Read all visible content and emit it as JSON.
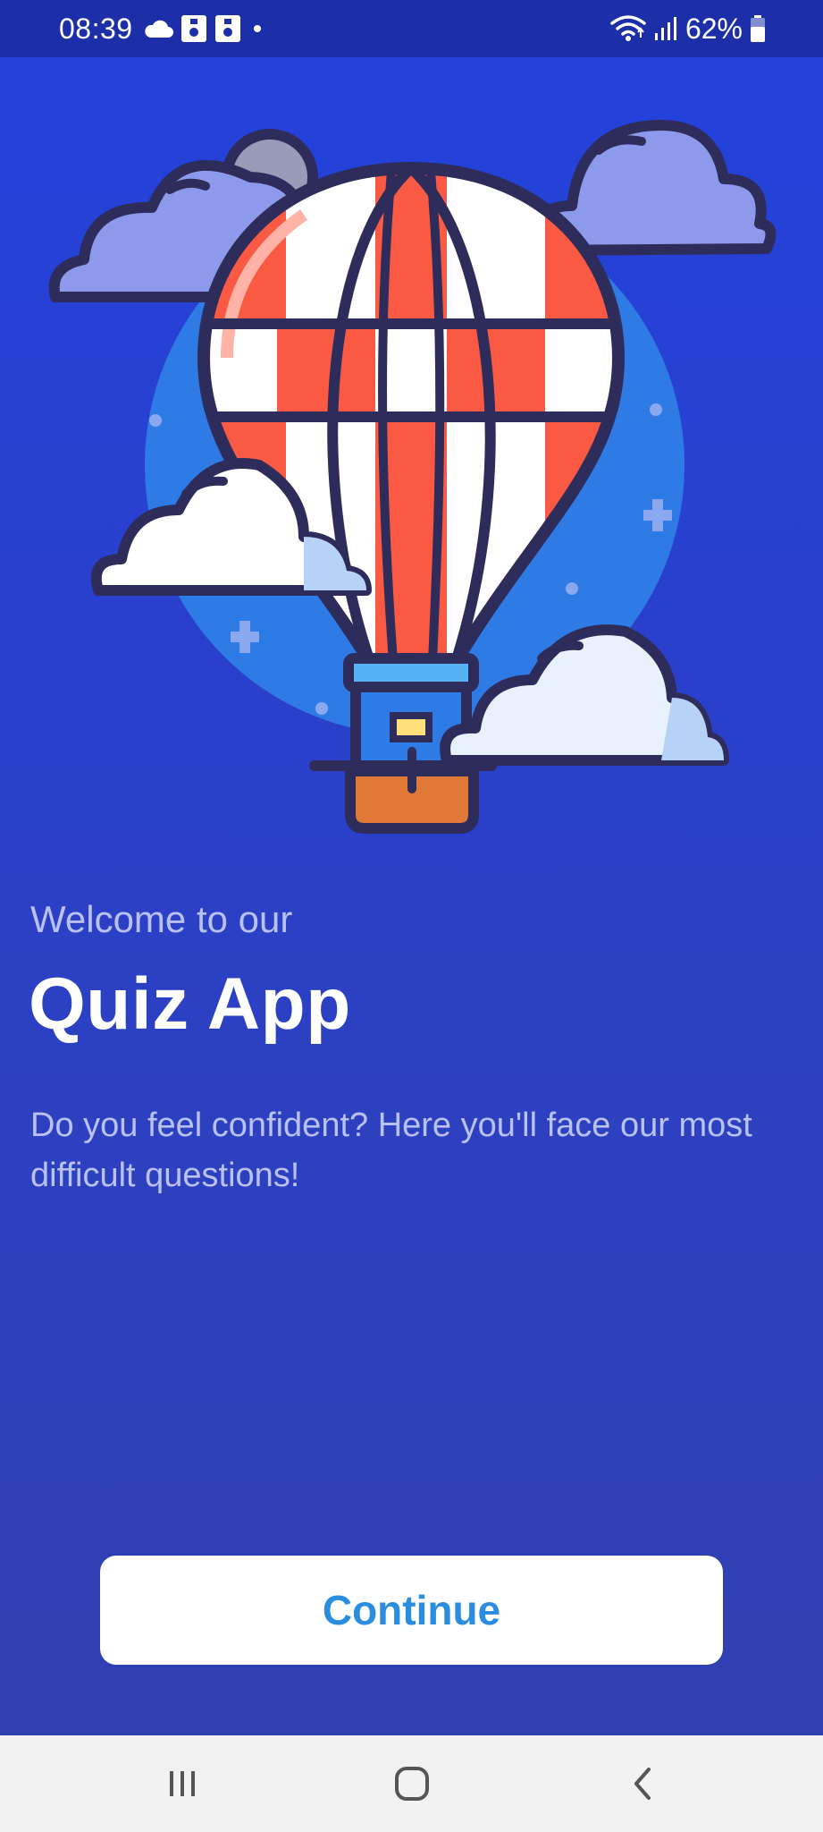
{
  "status_bar": {
    "time": "08:39",
    "battery": "62%",
    "icons": [
      "cloud-icon",
      "sim-card-icon",
      "sim-card-icon",
      "notification-dot-icon",
      "wifi-icon",
      "signal-icon",
      "battery-icon"
    ]
  },
  "hero": {
    "illustration": "hot-air-balloon-illustration"
  },
  "content": {
    "welcome": "Welcome to our",
    "title": "Quiz App",
    "subtitle": "Do you feel confident? Here you'll face our most difficult questions!"
  },
  "actions": {
    "continue_label": "Continue"
  },
  "nav_bar": {
    "icons": [
      "recent-apps-icon",
      "home-icon",
      "back-icon"
    ]
  },
  "colors": {
    "background_top": "#2342dc",
    "background_bottom": "#3040b0",
    "status_bar": "#1c2fa8",
    "button_text": "#2a8de0",
    "balloon_red": "#fa5a44",
    "outline": "#2e2c5b"
  }
}
